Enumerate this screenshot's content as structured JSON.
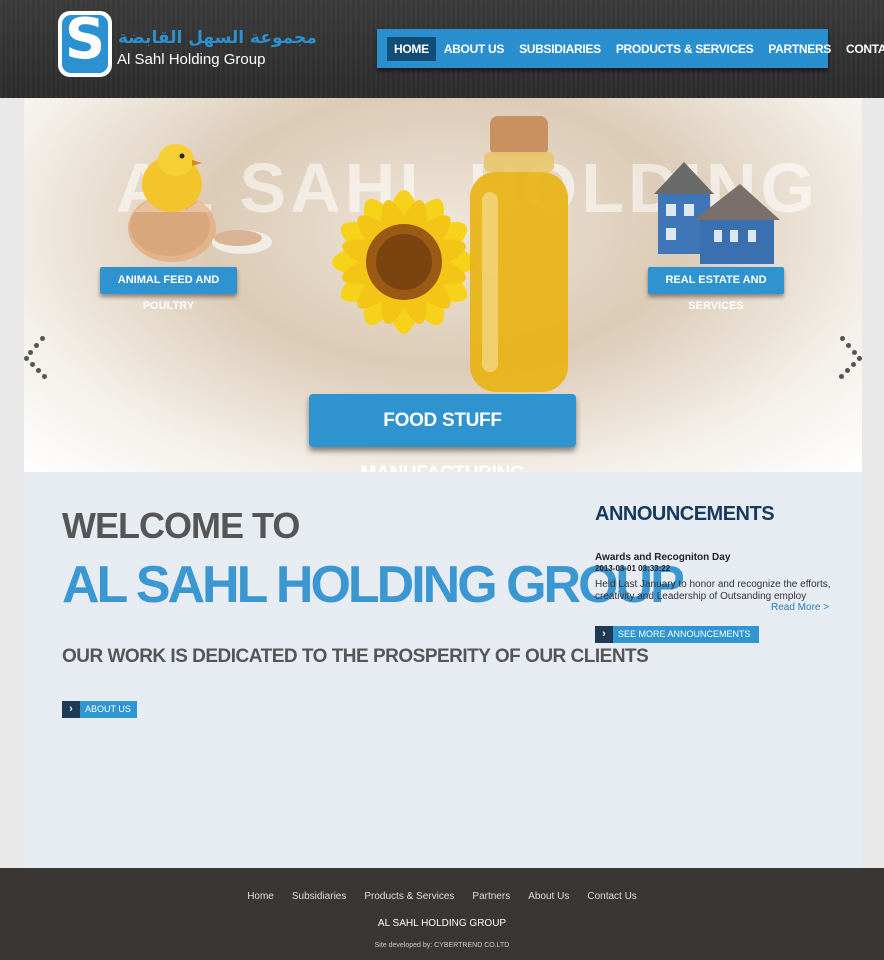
{
  "header": {
    "logo_letter": "S",
    "logo_arabic": "مجموعة السهل القابضة",
    "logo_english": "Al Sahl Holding Group"
  },
  "nav": {
    "items": [
      {
        "label": "HOME",
        "active": true
      },
      {
        "label": "ABOUT US"
      },
      {
        "label": "SUBSIDIARIES"
      },
      {
        "label": "PRODUCTS & SERVICES"
      },
      {
        "label": "PARTNERS"
      },
      {
        "label": "CONTACT US"
      }
    ]
  },
  "hero": {
    "background_text": "AL SAHL     HOLDING",
    "label_left": "ANIMAL FEED AND POULTRY",
    "label_right": "REAL ESTATE AND SERVICES",
    "label_center": "FOOD STUFF MANUFACTURING"
  },
  "main": {
    "welcome": "WELCOME TO",
    "company": "AL SAHL HOLDING GROUP",
    "tagline": "OUR WORK IS DEDICATED TO THE PROSPERITY OF OUR CLIENTS",
    "about_button": "ABOUT US"
  },
  "announcements": {
    "title": "ANNOUNCEMENTS",
    "item_title": "Awards and Recogniton Day",
    "item_date": "2013-03-01 03:33:22",
    "item_body": "Held Last January to honor and recognize the efforts, creativity and Leadership of Outsanding employ",
    "read_more": "Read More >",
    "see_more": "SEE MORE ANNOUNCEMENTS"
  },
  "footer": {
    "links": [
      "Home",
      "Subsidiaries",
      "Products & Services",
      "Partners",
      "About Us",
      "Contact Us"
    ],
    "company": "AL SAHL HOLDING GROUP",
    "credit": "Site developed by: CYBERTREND CO.LTD"
  },
  "colors": {
    "accent": "#2f93d0",
    "nav_active": "#124d78",
    "header_bg": "#2f2f2f",
    "footer_bg": "#3a3634",
    "content_bg": "#e7ebf2"
  }
}
